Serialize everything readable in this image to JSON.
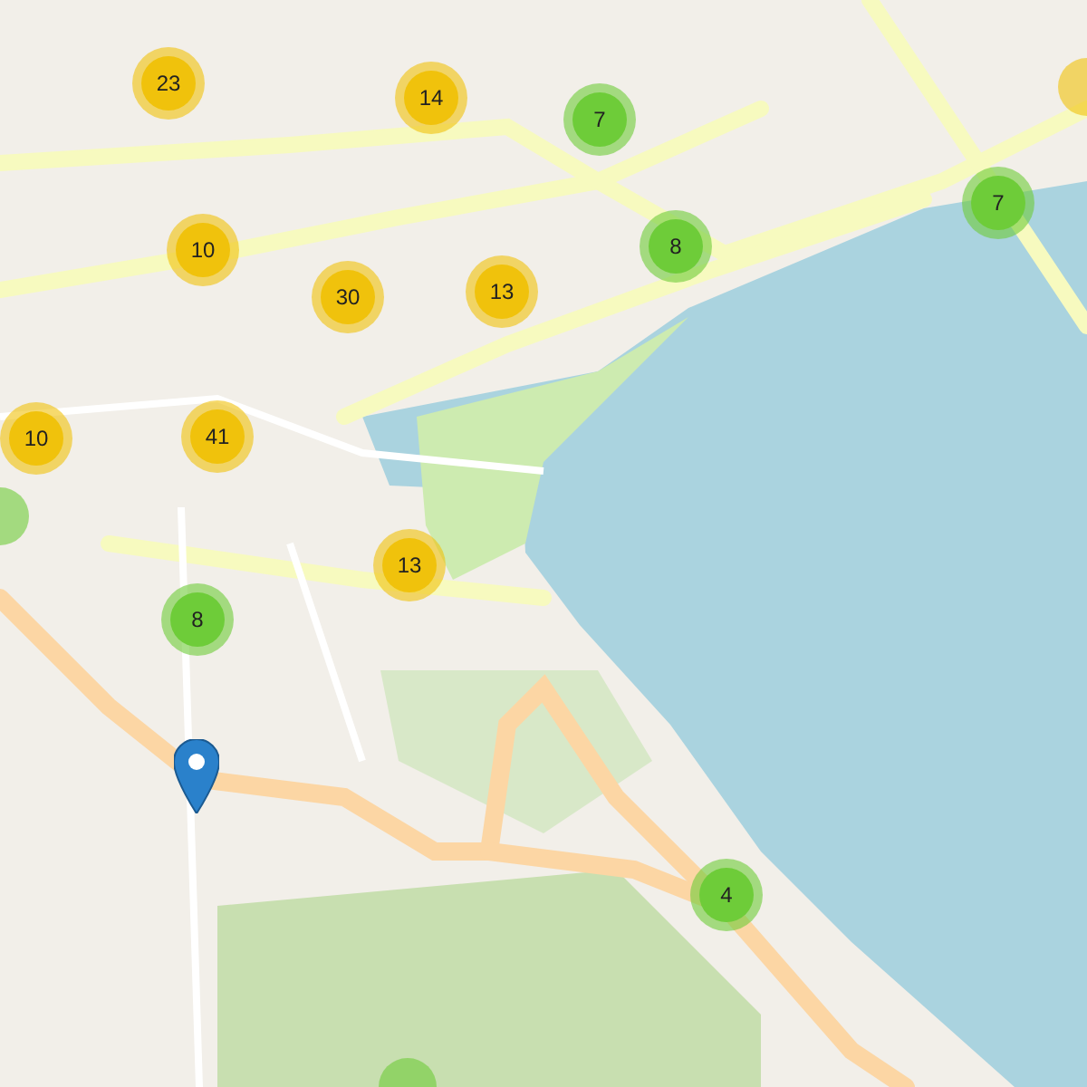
{
  "clusters": [
    {
      "count": "23",
      "color": "#f0c20c"
    },
    {
      "count": "14",
      "color": "#f0c20c"
    },
    {
      "count": "7",
      "color": "#6ecc39"
    },
    {
      "count": "7",
      "color": "#6ecc39"
    },
    {
      "count": "10",
      "color": "#f0c20c"
    },
    {
      "count": "8",
      "color": "#6ecc39"
    },
    {
      "count": "30",
      "color": "#f0c20c"
    },
    {
      "count": "13",
      "color": "#f0c20c"
    },
    {
      "count": "10",
      "color": "#f0c20c"
    },
    {
      "count": "41",
      "color": "#f0c20c"
    },
    {
      "count": "13",
      "color": "#f0c20c"
    },
    {
      "count": "8",
      "color": "#6ecc39"
    },
    {
      "count": "4",
      "color": "#6ecc39"
    }
  ]
}
